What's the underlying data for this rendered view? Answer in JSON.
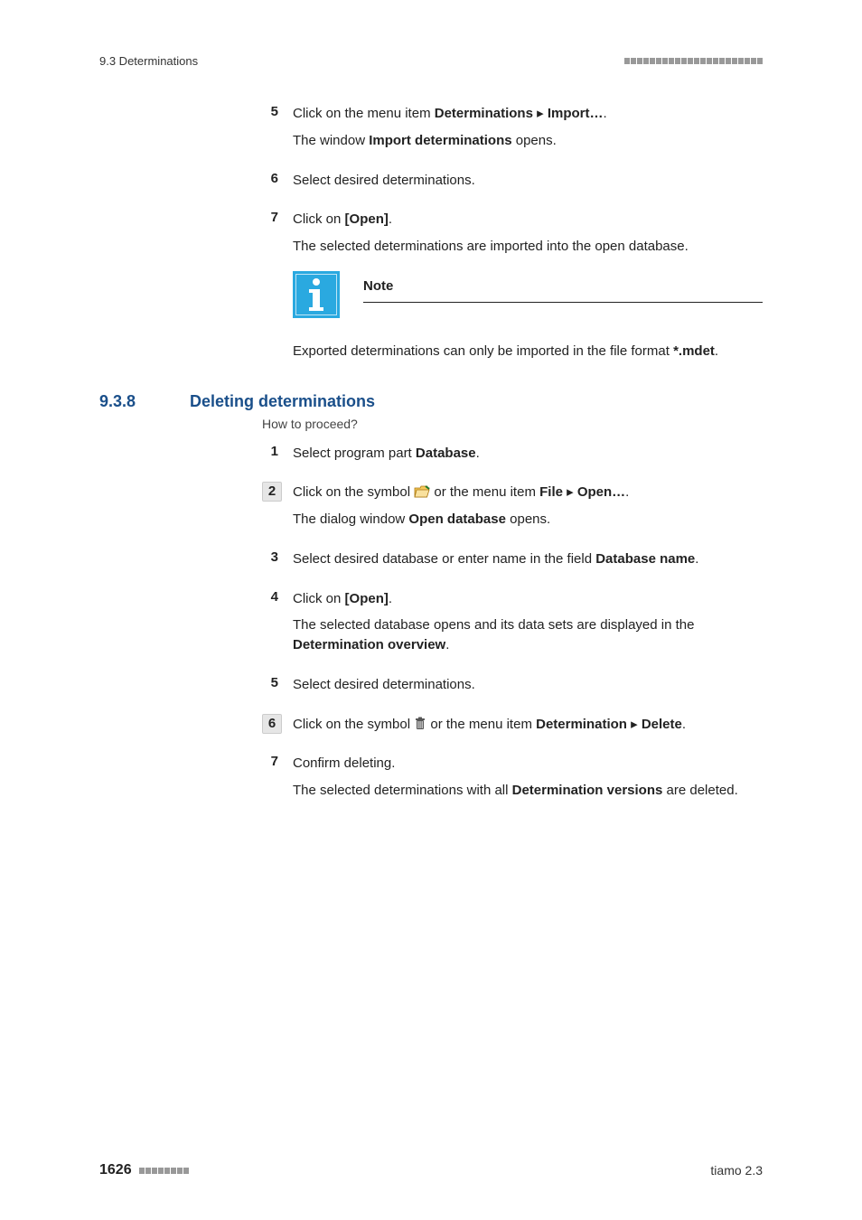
{
  "header": {
    "section": "9.3 Determinations"
  },
  "steps_a": {
    "s5": {
      "num": "5",
      "line1_a": "Click on the menu item ",
      "line1_b": "Determinations",
      "line1_c": " ▸ ",
      "line1_d": "Import…",
      "line1_e": ".",
      "line2_a": "The window ",
      "line2_b": "Import determinations",
      "line2_c": " opens."
    },
    "s6": {
      "num": "6",
      "text": "Select desired determinations."
    },
    "s7": {
      "num": "7",
      "l1_a": "Click on ",
      "l1_b": "[Open]",
      "l1_c": ".",
      "l2": "The selected determinations are imported into the open database."
    }
  },
  "note": {
    "title": "Note",
    "body_a": "Exported determinations can only be imported in the file format ",
    "body_b": "*.mdet",
    "body_c": "."
  },
  "heading": {
    "num": "9.3.8",
    "title": "Deleting determinations"
  },
  "proceed": "How to proceed?",
  "steps_b": {
    "s1": {
      "num": "1",
      "a": "Select program part ",
      "b": "Database",
      "c": "."
    },
    "s2": {
      "num": "2",
      "a": "Click on the symbol ",
      "b": " or the menu item ",
      "c": "File",
      "d": " ▸ ",
      "e": "Open…",
      "f": ".",
      "l2a": "The dialog window ",
      "l2b": "Open database",
      "l2c": " opens."
    },
    "s3": {
      "num": "3",
      "a": "Select desired database or enter name in the field ",
      "b": "Database name",
      "c": "."
    },
    "s4": {
      "num": "4",
      "a": "Click on ",
      "b": "[Open]",
      "c": ".",
      "l2a": "The selected database opens and its data sets are displayed in the ",
      "l2b": "Determination overview",
      "l2c": "."
    },
    "s5": {
      "num": "5",
      "text": "Select desired determinations."
    },
    "s6": {
      "num": "6",
      "a": "Click on the symbol ",
      "b": " or the menu item ",
      "c": "Determination",
      "d": " ▸ ",
      "e": "Delete",
      "f": "."
    },
    "s7": {
      "num": "7",
      "a": "Confirm deleting.",
      "l2a": "The selected determinations with all ",
      "l2b": "Determination versions",
      "l2c": " are deleted."
    }
  },
  "footer": {
    "page": "1626",
    "product": "tiamo 2.3"
  }
}
